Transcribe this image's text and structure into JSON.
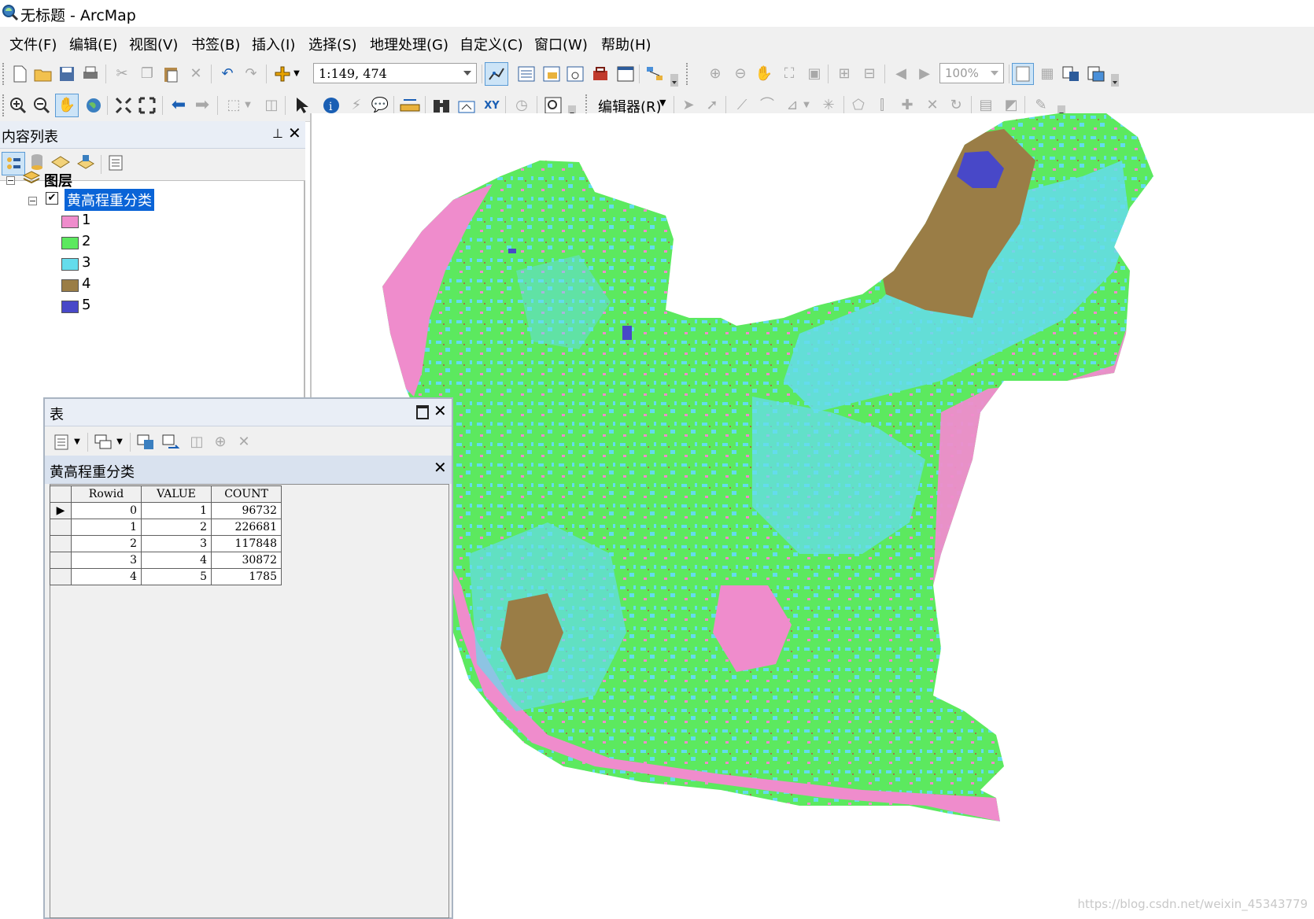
{
  "window": {
    "title": "无标题 - ArcMap"
  },
  "menu": [
    "文件(F)",
    "编辑(E)",
    "视图(V)",
    "书签(B)",
    "插入(I)",
    "选择(S)",
    "地理处理(G)",
    "自定义(C)",
    "窗口(W)",
    "帮助(H)"
  ],
  "toolbar": {
    "scale": "1:149, 474",
    "zoom": "100%",
    "editor_label": "编辑器(R)"
  },
  "toc": {
    "title": "内容列表",
    "root_label": "图层",
    "layer_name": "黄高程重分类",
    "legend": [
      {
        "label": "1",
        "color": "#ef8ccc"
      },
      {
        "label": "2",
        "color": "#5ce95f"
      },
      {
        "label": "3",
        "color": "#64dcec"
      },
      {
        "label": "4",
        "color": "#9a7d46"
      },
      {
        "label": "5",
        "color": "#4848c8"
      }
    ]
  },
  "table_window": {
    "title": "表",
    "tab_name": "黄高程重分类",
    "columns": [
      "Rowid",
      "VALUE",
      "COUNT"
    ],
    "rows": [
      [
        "0",
        "1",
        "96732"
      ],
      [
        "1",
        "2",
        "226681"
      ],
      [
        "2",
        "3",
        "117848"
      ],
      [
        "3",
        "4",
        "30872"
      ],
      [
        "4",
        "5",
        "1785"
      ]
    ]
  },
  "watermark": "https://blog.csdn.net/weixin_45343779"
}
